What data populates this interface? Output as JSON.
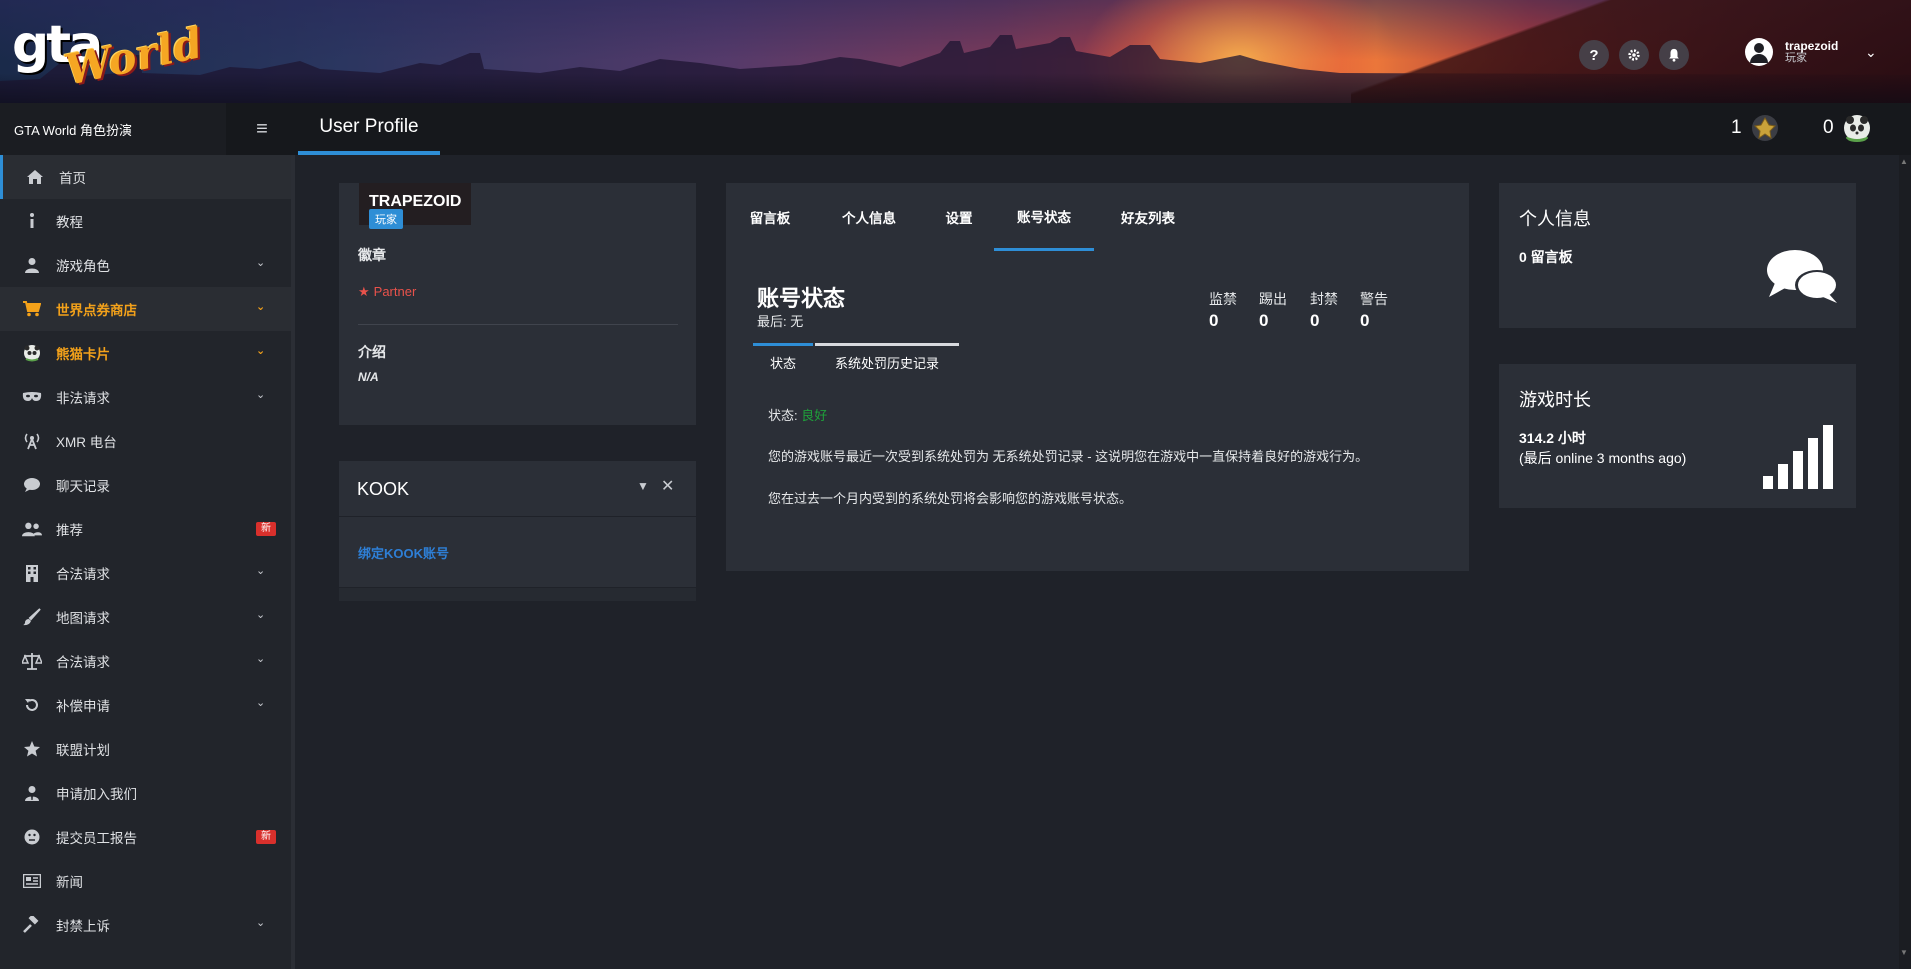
{
  "banner": {
    "logo_gta": "gta",
    "logo_world": "World",
    "help_icon_glyph": "?",
    "username": "trapezoid",
    "user_role": "玩家"
  },
  "topbar": {
    "brand": "GTA World 角色扮演",
    "page_title": "User Profile",
    "counter_1": "1",
    "counter_2": "0"
  },
  "sidebar": {
    "items": [
      {
        "label": "首页",
        "icon": "home-icon"
      },
      {
        "label": "教程",
        "icon": "info-icon"
      },
      {
        "label": "游戏角色",
        "icon": "user-icon"
      },
      {
        "label": "世界点券商店",
        "icon": "cart-icon"
      },
      {
        "label": "熊猫卡片",
        "icon": "panda-icon"
      },
      {
        "label": "非法请求",
        "icon": "mask-icon"
      },
      {
        "label": "XMR 电台",
        "icon": "radio-icon"
      },
      {
        "label": "聊天记录",
        "icon": "chat-icon"
      },
      {
        "label": "推荐",
        "icon": "users-icon",
        "badge": "新"
      },
      {
        "label": "合法请求",
        "icon": "building-icon"
      },
      {
        "label": "地图请求",
        "icon": "brush-icon"
      },
      {
        "label": "合法请求",
        "icon": "scale-icon"
      },
      {
        "label": "补偿申请",
        "icon": "undo-icon"
      },
      {
        "label": "联盟计划",
        "icon": "star-icon"
      },
      {
        "label": "申请加入我们",
        "icon": "user-tie-icon"
      },
      {
        "label": "提交员工报告",
        "icon": "face-icon",
        "badge": "新"
      },
      {
        "label": "新闻",
        "icon": "newspaper-icon"
      },
      {
        "label": "封禁上诉",
        "icon": "gavel-icon"
      }
    ]
  },
  "profile": {
    "name": "TRAPEZOID",
    "role": "玩家",
    "badges_label": "徽章",
    "partner": "Partner",
    "intro_label": "介绍",
    "intro_value": "N/A"
  },
  "kook": {
    "title": "KOOK",
    "bind_link": "绑定KOOK账号"
  },
  "account": {
    "tabs": [
      "留言板",
      "个人信息",
      "设置",
      "账号状态",
      "好友列表"
    ],
    "title": "账号状态",
    "last": "最后: 无",
    "stats": [
      {
        "label": "监禁",
        "value": "0"
      },
      {
        "label": "踢出",
        "value": "0"
      },
      {
        "label": "封禁",
        "value": "0"
      },
      {
        "label": "警告",
        "value": "0"
      }
    ],
    "subtabs": [
      "状态",
      "系统处罚历史记录"
    ],
    "status_label": "状态:",
    "status_value": "良好",
    "para1": "您的游戏账号最近一次受到系统处罚为 无系统处罚记录 - 这说明您在游戏中一直保持着良好的游戏行为。",
    "para2": "您在过去一个月内受到的系统处罚将会影响您的游戏账号状态。"
  },
  "info_card": {
    "title": "个人信息",
    "messages": "0 留言板"
  },
  "time_card": {
    "title": "游戏时长",
    "hours": "314.2 小时",
    "last_online": "(最后 online 3 months ago)"
  },
  "colors": {
    "accent": "#2e8ed6",
    "orange": "#f3a11a",
    "partner": "#e8524b",
    "status_good": "#1fa03b",
    "badge_new": "#d9302c"
  }
}
